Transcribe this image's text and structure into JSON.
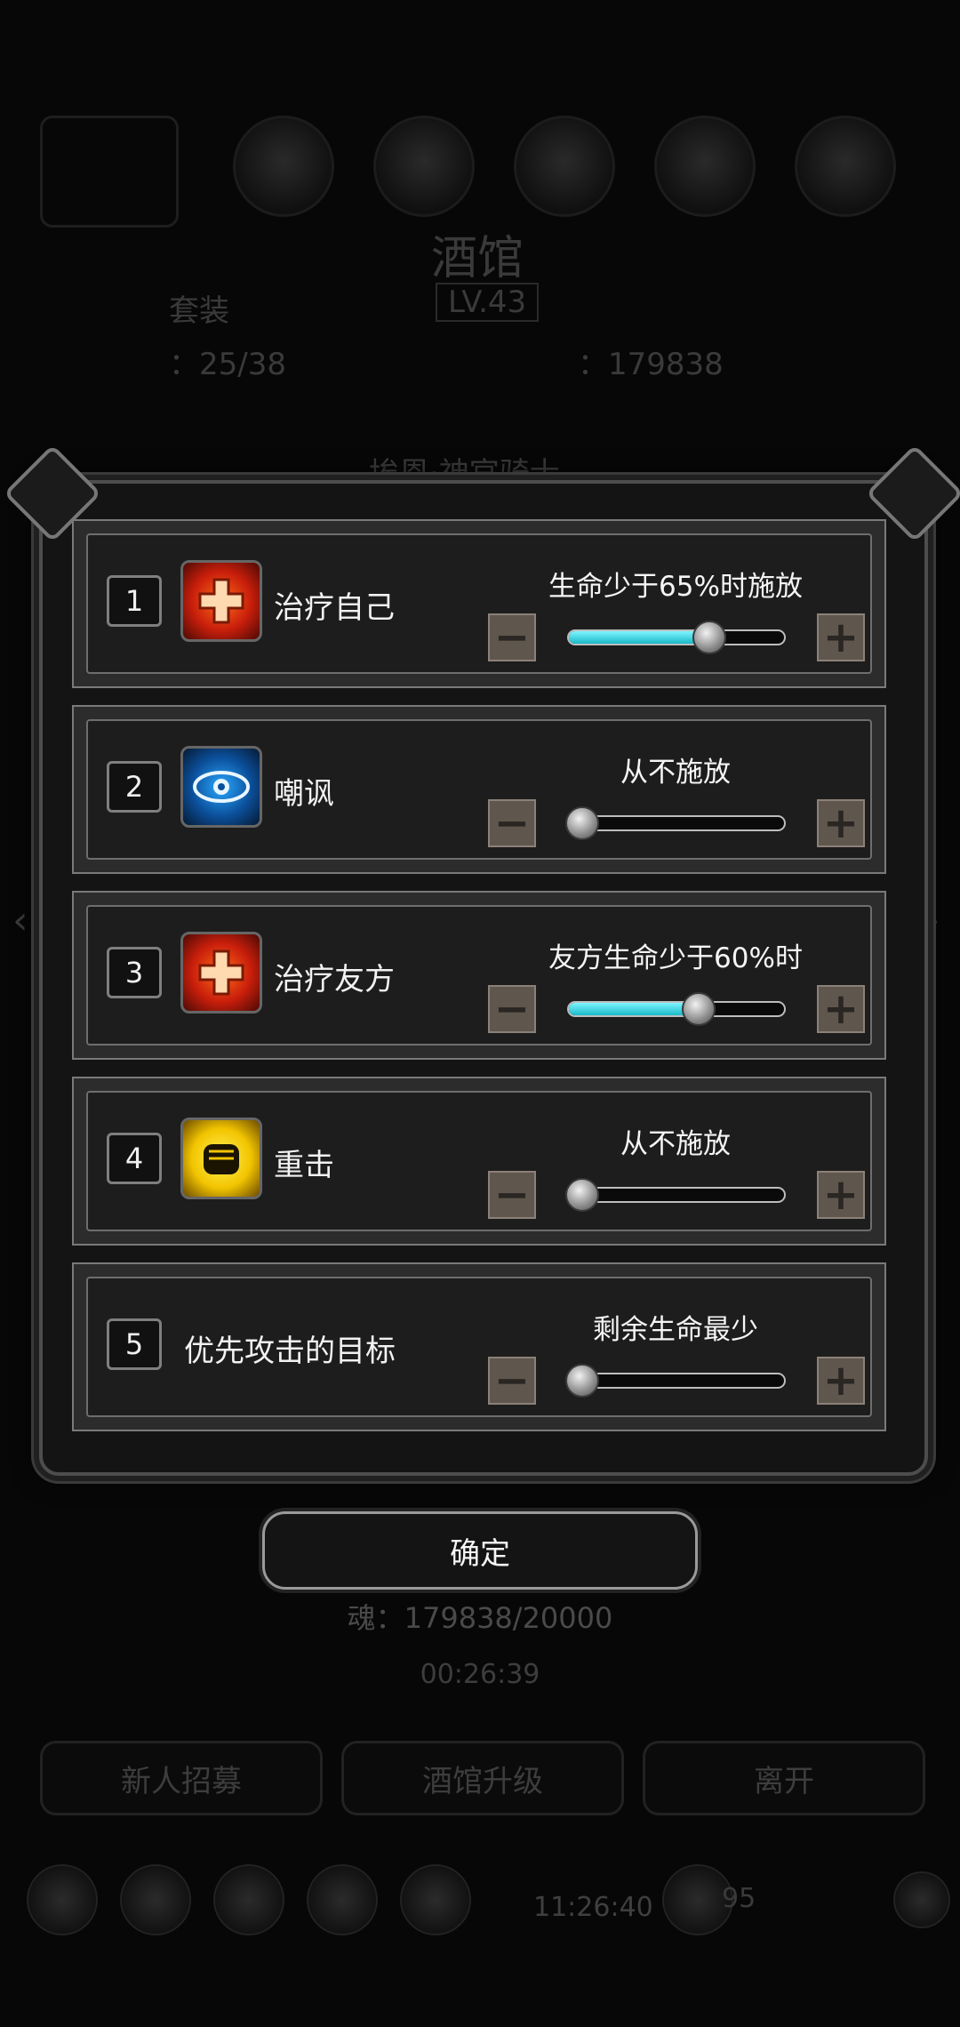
{
  "background": {
    "title_fragment": "酒馆",
    "level": "LV.43",
    "left_label": "套装",
    "stat_left": "：25/38",
    "stat_right": "：179838",
    "banner_text": "埃恩·神官骑士",
    "soul": "魂：179838/20000",
    "timer": "00:26:39",
    "buttons": [
      "新人招募",
      "酒馆升级",
      "离开"
    ],
    "clock": "11:26:40",
    "count": "95"
  },
  "rows": [
    {
      "number": "1",
      "icon": "heal-icon",
      "name": "治疗自己",
      "condition": "生命少于65%时施放",
      "slider_fraction": 0.65
    },
    {
      "number": "2",
      "icon": "taunt-eye-icon",
      "name": "嘲讽",
      "condition": "从不施放",
      "slider_fraction": 0.0
    },
    {
      "number": "3",
      "icon": "heal-icon",
      "name": "治疗友方",
      "condition": "友方生命少于60%时",
      "slider_fraction": 0.6
    },
    {
      "number": "4",
      "icon": "fist-strike-icon",
      "name": "重击",
      "condition": "从不施放",
      "slider_fraction": 0.0
    },
    {
      "number": "5",
      "icon": null,
      "name": "优先攻击的目标",
      "condition": "剩余生命最少",
      "slider_fraction": 0.0
    }
  ],
  "confirm_label": "确定",
  "colors": {
    "slider_fill": "#1ab8c8",
    "panel": "#1d1d1d",
    "stepper": "#5f564d"
  }
}
